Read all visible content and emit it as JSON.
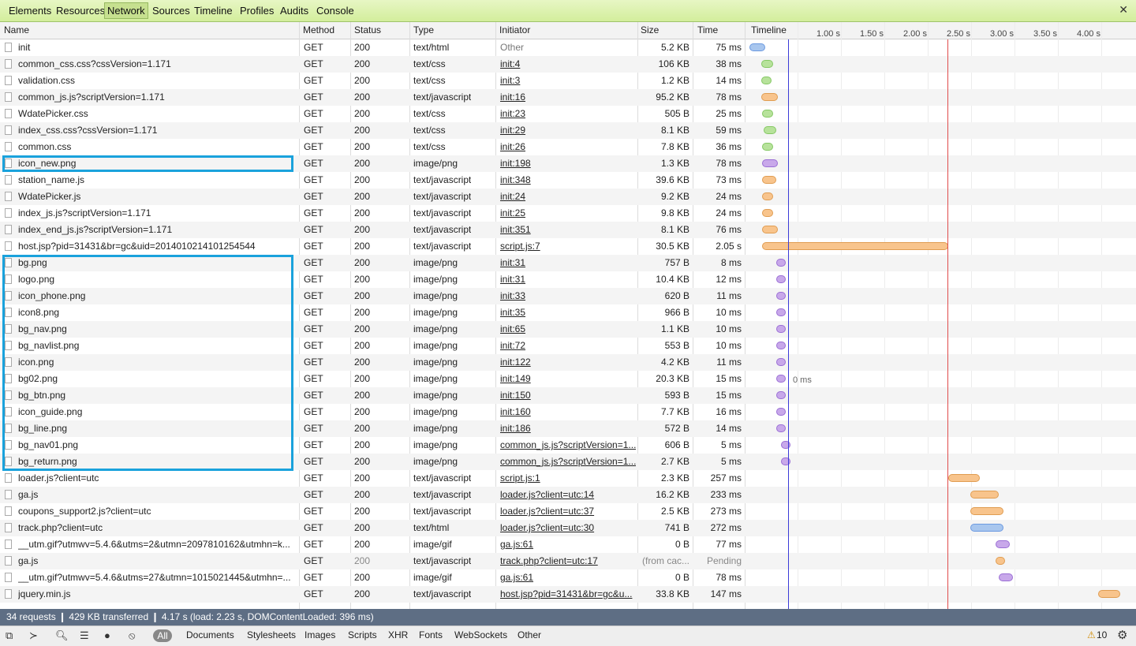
{
  "tabs": [
    "Elements",
    "Resources",
    "Network",
    "Sources",
    "Timeline",
    "Profiles",
    "Audits",
    "Console"
  ],
  "columns": {
    "name": "Name",
    "method": "Method",
    "status": "Status",
    "type": "Type",
    "initiator": "Initiator",
    "size": "Size",
    "time": "Time",
    "timeline": "Timeline"
  },
  "ticks": [
    "1.00 s",
    "1.50 s",
    "2.00 s",
    "2.50 s",
    "3.00 s",
    "3.50 s",
    "4.00 s"
  ],
  "rows": [
    {
      "name": "init",
      "method": "GET",
      "status": "200",
      "type": "text/html",
      "initiator": "Other",
      "size": "5.2 KB",
      "time": "75 ms",
      "kind": "html"
    },
    {
      "name": "common_css.css?cssVersion=1.171",
      "method": "GET",
      "status": "200",
      "type": "text/css",
      "initiator": "init:4",
      "size": "106 KB",
      "time": "38 ms",
      "kind": "css"
    },
    {
      "name": "validation.css",
      "method": "GET",
      "status": "200",
      "type": "text/css",
      "initiator": "init:3",
      "size": "1.2 KB",
      "time": "14 ms",
      "kind": "css"
    },
    {
      "name": "common_js.js?scriptVersion=1.171",
      "method": "GET",
      "status": "200",
      "type": "text/javascript",
      "initiator": "init:16",
      "size": "95.2 KB",
      "time": "78 ms",
      "kind": "js"
    },
    {
      "name": "WdatePicker.css",
      "method": "GET",
      "status": "200",
      "type": "text/css",
      "initiator": "init:23",
      "size": "505 B",
      "time": "25 ms",
      "kind": "css"
    },
    {
      "name": "index_css.css?cssVersion=1.171",
      "method": "GET",
      "status": "200",
      "type": "text/css",
      "initiator": "init:29",
      "size": "8.1 KB",
      "time": "59 ms",
      "kind": "css"
    },
    {
      "name": "common.css",
      "method": "GET",
      "status": "200",
      "type": "text/css",
      "initiator": "init:26",
      "size": "7.8 KB",
      "time": "36 ms",
      "kind": "css"
    },
    {
      "name": "icon_new.png",
      "method": "GET",
      "status": "200",
      "type": "image/png",
      "initiator": "init:198",
      "size": "1.3 KB",
      "time": "78 ms",
      "kind": "img"
    },
    {
      "name": "station_name.js",
      "method": "GET",
      "status": "200",
      "type": "text/javascript",
      "initiator": "init:348",
      "size": "39.6 KB",
      "time": "73 ms",
      "kind": "js"
    },
    {
      "name": "WdatePicker.js",
      "method": "GET",
      "status": "200",
      "type": "text/javascript",
      "initiator": "init:24",
      "size": "9.2 KB",
      "time": "24 ms",
      "kind": "js"
    },
    {
      "name": "index_js.js?scriptVersion=1.171",
      "method": "GET",
      "status": "200",
      "type": "text/javascript",
      "initiator": "init:25",
      "size": "9.8 KB",
      "time": "24 ms",
      "kind": "js"
    },
    {
      "name": "index_end_js.js?scriptVersion=1.171",
      "method": "GET",
      "status": "200",
      "type": "text/javascript",
      "initiator": "init:351",
      "size": "8.1 KB",
      "time": "76 ms",
      "kind": "js"
    },
    {
      "name": "host.jsp?pid=31431&br=gc&uid=2014010214101254544",
      "method": "GET",
      "status": "200",
      "type": "text/javascript",
      "initiator": "script.js:7",
      "size": "30.5 KB",
      "time": "2.05 s",
      "kind": "js"
    },
    {
      "name": "bg.png",
      "method": "GET",
      "status": "200",
      "type": "image/png",
      "initiator": "init:31",
      "size": "757 B",
      "time": "8 ms",
      "kind": "img"
    },
    {
      "name": "logo.png",
      "method": "GET",
      "status": "200",
      "type": "image/png",
      "initiator": "init:31",
      "size": "10.4 KB",
      "time": "12 ms",
      "kind": "img"
    },
    {
      "name": "icon_phone.png",
      "method": "GET",
      "status": "200",
      "type": "image/png",
      "initiator": "init:33",
      "size": "620 B",
      "time": "11 ms",
      "kind": "img"
    },
    {
      "name": "icon8.png",
      "method": "GET",
      "status": "200",
      "type": "image/png",
      "initiator": "init:35",
      "size": "966 B",
      "time": "10 ms",
      "kind": "img"
    },
    {
      "name": "bg_nav.png",
      "method": "GET",
      "status": "200",
      "type": "image/png",
      "initiator": "init:65",
      "size": "1.1 KB",
      "time": "10 ms",
      "kind": "img"
    },
    {
      "name": "bg_navlist.png",
      "method": "GET",
      "status": "200",
      "type": "image/png",
      "initiator": "init:72",
      "size": "553 B",
      "time": "10 ms",
      "kind": "img"
    },
    {
      "name": "icon.png",
      "method": "GET",
      "status": "200",
      "type": "image/png",
      "initiator": "init:122",
      "size": "4.2 KB",
      "time": "11 ms",
      "kind": "img"
    },
    {
      "name": "bg02.png",
      "method": "GET",
      "status": "200",
      "type": "image/png",
      "initiator": "init:149",
      "size": "20.3 KB",
      "time": "15 ms",
      "kind": "img"
    },
    {
      "name": "bg_btn.png",
      "method": "GET",
      "status": "200",
      "type": "image/png",
      "initiator": "init:150",
      "size": "593 B",
      "time": "15 ms",
      "kind": "img"
    },
    {
      "name": "icon_guide.png",
      "method": "GET",
      "status": "200",
      "type": "image/png",
      "initiator": "init:160",
      "size": "7.7 KB",
      "time": "16 ms",
      "kind": "img"
    },
    {
      "name": "bg_line.png",
      "method": "GET",
      "status": "200",
      "type": "image/png",
      "initiator": "init:186",
      "size": "572 B",
      "time": "14 ms",
      "kind": "img"
    },
    {
      "name": "bg_nav01.png",
      "method": "GET",
      "status": "200",
      "type": "image/png",
      "initiator": "common_js.js?scriptVersion=1...",
      "size": "606 B",
      "time": "5 ms",
      "kind": "img"
    },
    {
      "name": "bg_return.png",
      "method": "GET",
      "status": "200",
      "type": "image/png",
      "initiator": "common_js.js?scriptVersion=1...",
      "size": "2.7 KB",
      "time": "5 ms",
      "kind": "img"
    },
    {
      "name": "loader.js?client=utc",
      "method": "GET",
      "status": "200",
      "type": "text/javascript",
      "initiator": "script.js:1",
      "size": "2.3 KB",
      "time": "257 ms",
      "kind": "js"
    },
    {
      "name": "ga.js",
      "method": "GET",
      "status": "200",
      "type": "text/javascript",
      "initiator": "loader.js?client=utc:14",
      "size": "16.2 KB",
      "time": "233 ms",
      "kind": "js"
    },
    {
      "name": "coupons_support2.js?client=utc",
      "method": "GET",
      "status": "200",
      "type": "text/javascript",
      "initiator": "loader.js?client=utc:37",
      "size": "2.5 KB",
      "time": "273 ms",
      "kind": "js"
    },
    {
      "name": "track.php?client=utc",
      "method": "GET",
      "status": "200",
      "type": "text/html",
      "initiator": "loader.js?client=utc:30",
      "size": "741 B",
      "time": "272 ms",
      "kind": "html"
    },
    {
      "name": "__utm.gif?utmwv=5.4.6&utms=2&utmn=2097810162&utmhn=k...",
      "method": "GET",
      "status": "200",
      "type": "image/gif",
      "initiator": "ga.js:61",
      "size": "0 B",
      "time": "77 ms",
      "kind": "gif"
    },
    {
      "name": "ga.js",
      "method": "GET",
      "status": "200",
      "type": "text/javascript",
      "initiator": "track.php?client=utc:17",
      "size": "(from cac...",
      "time": "Pending",
      "kind": "js",
      "dim": true
    },
    {
      "name": "__utm.gif?utmwv=5.4.6&utms=27&utmn=1015021445&utmhn=...",
      "method": "GET",
      "status": "200",
      "type": "image/gif",
      "initiator": "ga.js:61",
      "size": "0 B",
      "time": "78 ms",
      "kind": "gif"
    },
    {
      "name": "jquery.min.js",
      "method": "GET",
      "status": "200",
      "type": "text/javascript",
      "initiator": "host.jsp?pid=31431&br=gc&u...",
      "size": "33.8 KB",
      "time": "147 ms",
      "kind": "js"
    }
  ],
  "bar_hover_label": "0 ms",
  "status_text": "34 requests  ❙  429 KB transferred  ❙  4.17 s (load: 2.23 s, DOMContentLoaded: 396 ms)",
  "filters": {
    "all": "All",
    "items": [
      "Documents",
      "Stylesheets",
      "Images",
      "Scripts",
      "XHR",
      "Fonts",
      "WebSockets",
      "Other"
    ]
  },
  "warnings": "10",
  "colors": {
    "highlight_box": "#1aa2dc",
    "toolbar": "#d3ee9c",
    "statusbar": "#5e6e84"
  }
}
